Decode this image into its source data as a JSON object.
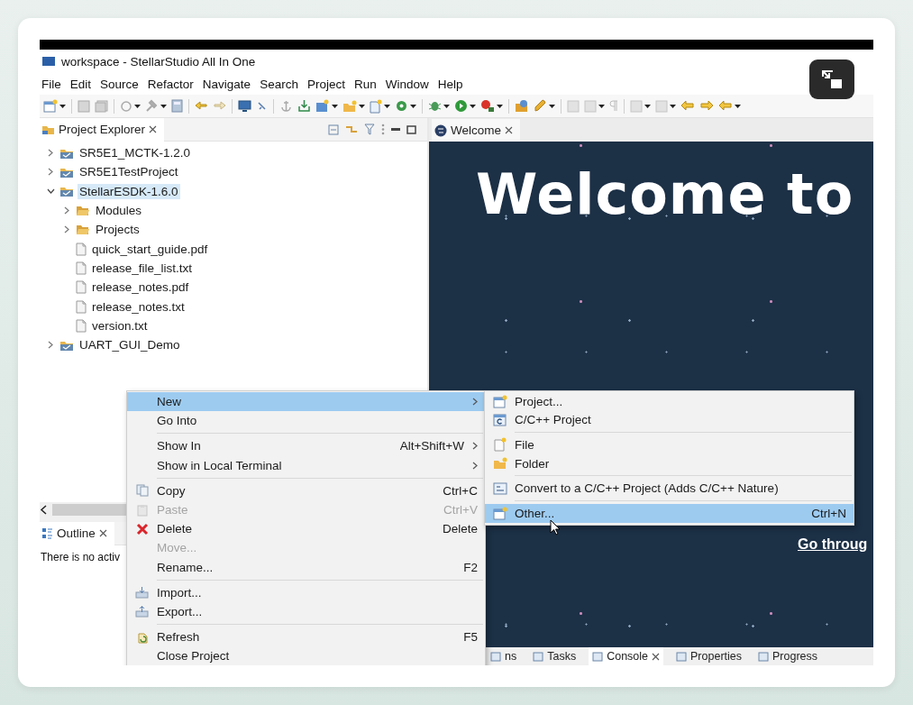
{
  "window": {
    "title": "workspace - StellarStudio All In One"
  },
  "menu_bar": [
    {
      "label": "File"
    },
    {
      "label": "Edit"
    },
    {
      "label": "Source"
    },
    {
      "label": "Refactor"
    },
    {
      "label": "Navigate"
    },
    {
      "label": "Search"
    },
    {
      "label": "Project"
    },
    {
      "label": "Run"
    },
    {
      "label": "Window"
    },
    {
      "label": "Help"
    }
  ],
  "explorer": {
    "tab": {
      "label": "Project Explorer",
      "selected": true
    },
    "tree": [
      {
        "label": "SR5E1_MCTK-1.2.0",
        "kind": "project",
        "expanded": false,
        "selected": false
      },
      {
        "label": "SR5E1TestProject",
        "kind": "project",
        "expanded": false,
        "selected": false
      },
      {
        "label": "StellarESDK-1.6.0",
        "kind": "project",
        "expanded": true,
        "selected": true,
        "children": [
          {
            "label": "Modules",
            "kind": "folder",
            "expanded": false,
            "selected": false
          },
          {
            "label": "Projects",
            "kind": "folder",
            "expanded": false,
            "selected": false
          },
          {
            "label": "quick_start_guide.pdf",
            "kind": "file",
            "selected": false
          },
          {
            "label": "release_file_list.txt",
            "kind": "file",
            "selected": false
          },
          {
            "label": "release_notes.pdf",
            "kind": "file",
            "selected": false
          },
          {
            "label": "release_notes.txt",
            "kind": "file",
            "selected": false
          },
          {
            "label": "version.txt",
            "kind": "file",
            "selected": false
          }
        ]
      },
      {
        "label": "UART_GUI_Demo",
        "kind": "project",
        "expanded": false,
        "selected": false
      }
    ]
  },
  "outline": {
    "tab": {
      "label": "Outline",
      "selected": true
    },
    "message": "There is no activ"
  },
  "editor": {
    "tab": {
      "label": "Welcome",
      "selected": true
    },
    "heading": "Welcome to",
    "link": "Go throug"
  },
  "bottom_tabs": [
    {
      "label": "ns",
      "selected": false
    },
    {
      "label": "Tasks",
      "selected": false
    },
    {
      "label": "Console",
      "selected": true
    },
    {
      "label": "Properties",
      "selected": false
    },
    {
      "label": "Progress",
      "selected": false
    }
  ],
  "context_menu": [
    {
      "kind": "item",
      "label": "New",
      "submenu": true,
      "selected": true,
      "disabled": false
    },
    {
      "kind": "item",
      "label": "Go Into",
      "selected": false,
      "disabled": false
    },
    {
      "kind": "separator"
    },
    {
      "kind": "item",
      "label": "Show In",
      "shortcut": "Alt+Shift+W",
      "submenu": true,
      "selected": false,
      "disabled": false
    },
    {
      "kind": "item",
      "label": "Show in Local Terminal",
      "submenu": true,
      "selected": false,
      "disabled": false
    },
    {
      "kind": "separator"
    },
    {
      "kind": "item",
      "label": "Copy",
      "shortcut": "Ctrl+C",
      "selected": false,
      "disabled": false
    },
    {
      "kind": "item",
      "label": "Paste",
      "shortcut": "Ctrl+V",
      "selected": false,
      "disabled": true
    },
    {
      "kind": "item",
      "label": "Delete",
      "shortcut": "Delete",
      "selected": false,
      "disabled": false
    },
    {
      "kind": "item",
      "label": "Move...",
      "selected": false,
      "disabled": true
    },
    {
      "kind": "item",
      "label": "Rename...",
      "shortcut": "F2",
      "selected": false,
      "disabled": false
    },
    {
      "kind": "separator"
    },
    {
      "kind": "item",
      "label": "Import...",
      "selected": false,
      "disabled": false
    },
    {
      "kind": "item",
      "label": "Export...",
      "selected": false,
      "disabled": false
    },
    {
      "kind": "separator"
    },
    {
      "kind": "item",
      "label": "Refresh",
      "shortcut": "F5",
      "selected": false,
      "disabled": false
    },
    {
      "kind": "item",
      "label": "Close Project",
      "selected": false,
      "disabled": false
    }
  ],
  "submenu": [
    {
      "kind": "item",
      "label": "Project...",
      "selected": false,
      "disabled": false
    },
    {
      "kind": "item",
      "label": "C/C++ Project",
      "selected": false,
      "disabled": false
    },
    {
      "kind": "separator"
    },
    {
      "kind": "item",
      "label": "File",
      "selected": false,
      "disabled": false
    },
    {
      "kind": "item",
      "label": "Folder",
      "selected": false,
      "disabled": false
    },
    {
      "kind": "separator"
    },
    {
      "kind": "item",
      "label": "Convert to a C/C++ Project (Adds C/C++ Nature)",
      "selected": false,
      "disabled": false
    },
    {
      "kind": "separator"
    },
    {
      "kind": "item",
      "label": "Other...",
      "shortcut": "Ctrl+N",
      "selected": true,
      "disabled": false
    }
  ]
}
